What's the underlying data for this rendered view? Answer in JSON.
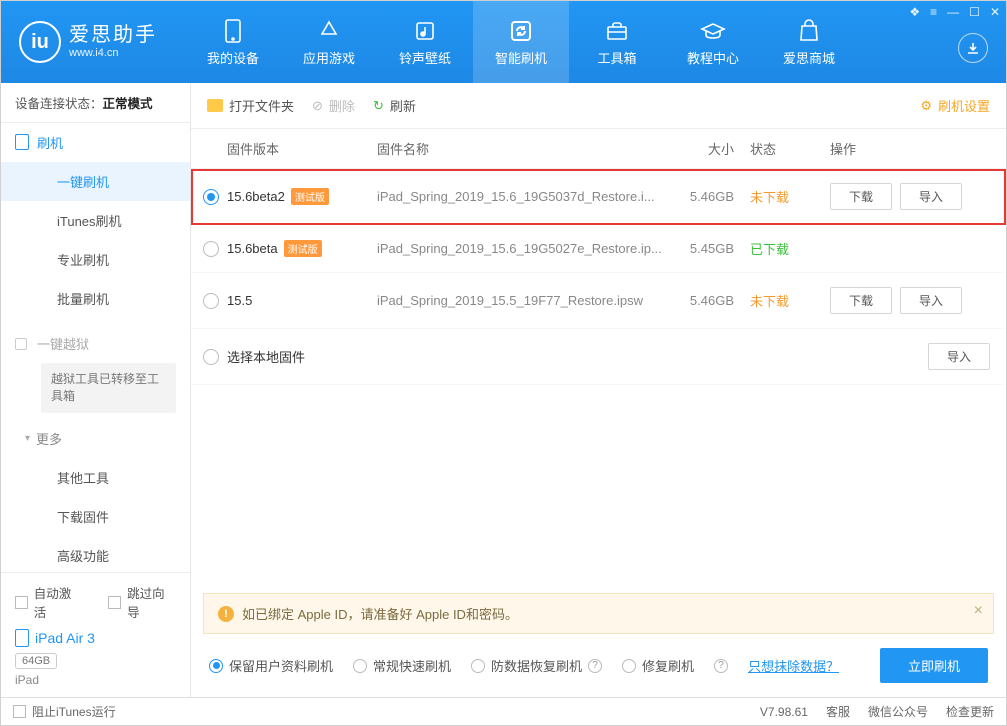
{
  "app": {
    "title": "爱思助手",
    "url": "www.i4.cn"
  },
  "topTabs": [
    {
      "label": "我的设备"
    },
    {
      "label": "应用游戏"
    },
    {
      "label": "铃声壁纸"
    },
    {
      "label": "智能刷机"
    },
    {
      "label": "工具箱"
    },
    {
      "label": "教程中心"
    },
    {
      "label": "爱思商城"
    }
  ],
  "conn": {
    "label": "设备连接状态：",
    "value": "正常模式"
  },
  "sidebar": {
    "primary": "刷机",
    "items": [
      "一键刷机",
      "iTunes刷机",
      "专业刷机",
      "批量刷机"
    ],
    "jailbreak": "一键越狱",
    "jailbreakNote": "越狱工具已转移至工具箱",
    "more": "更多",
    "moreItems": [
      "其他工具",
      "下载固件",
      "高级功能"
    ]
  },
  "sideBottom": {
    "autoActivate": "自动激活",
    "skipGuide": "跳过向导",
    "deviceName": "iPad Air 3",
    "capacity": "64GB",
    "deviceType": "iPad"
  },
  "toolbar": {
    "openFolder": "打开文件夹",
    "delete": "删除",
    "refresh": "刷新",
    "settings": "刷机设置"
  },
  "table": {
    "headers": {
      "version": "固件版本",
      "name": "固件名称",
      "size": "大小",
      "status": "状态",
      "op": "操作"
    },
    "rows": [
      {
        "version": "15.6beta2",
        "beta": "测试版",
        "name": "iPad_Spring_2019_15.6_19G5037d_Restore.i...",
        "size": "5.46GB",
        "status": "未下载",
        "statusClass": "st-orange",
        "download": "下载",
        "import": "导入",
        "selected": true,
        "highlight": true,
        "showOps": true
      },
      {
        "version": "15.6beta",
        "beta": "测试版",
        "name": "iPad_Spring_2019_15.6_19G5027e_Restore.ip...",
        "size": "5.45GB",
        "status": "已下载",
        "statusClass": "st-green",
        "selected": false,
        "showOps": false
      },
      {
        "version": "15.5",
        "beta": "",
        "name": "iPad_Spring_2019_15.5_19F77_Restore.ipsw",
        "size": "5.46GB",
        "status": "未下载",
        "statusClass": "st-orange",
        "download": "下载",
        "import": "导入",
        "selected": false,
        "showOps": true
      }
    ],
    "localRow": {
      "label": "选择本地固件",
      "import": "导入"
    }
  },
  "notice": "如已绑定 Apple ID，请准备好 Apple ID和密码。",
  "options": {
    "o1": "保留用户资料刷机",
    "o2": "常规快速刷机",
    "o3": "防数据恢复刷机",
    "o4": "修复刷机",
    "eraseLink": "只想抹除数据？",
    "flashBtn": "立即刷机"
  },
  "statusbar": {
    "blockItunes": "阻止iTunes运行",
    "version": "V7.98.61",
    "service": "客服",
    "wechat": "微信公众号",
    "update": "检查更新"
  }
}
